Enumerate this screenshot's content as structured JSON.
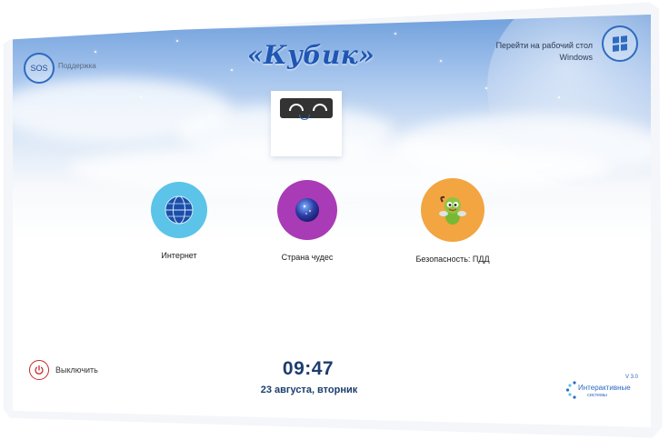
{
  "top_left": {
    "sos_label": "SOS",
    "support_label": "Поддержка"
  },
  "title": "«Кубик»",
  "windows": {
    "label": "Перейти на рабочий стол Windows"
  },
  "apps": [
    {
      "label": "Интернет",
      "icon": "globe-icon",
      "color": "#5bc4e8"
    },
    {
      "label": "Страна чудес",
      "icon": "magic-ball-icon",
      "color": "#a93bb6"
    },
    {
      "label": "Безопасность: ПДД",
      "icon": "bee-character-icon",
      "color": "#f2a541"
    }
  ],
  "power": {
    "label": "Выключить",
    "color": "#c62828"
  },
  "clock": {
    "time": "09:47",
    "date": "23 августа, вторник"
  },
  "brand": {
    "name": "Интерактивные",
    "sub": "системы",
    "version": "V 3.0"
  },
  "accent_color": "#2e6bbf"
}
